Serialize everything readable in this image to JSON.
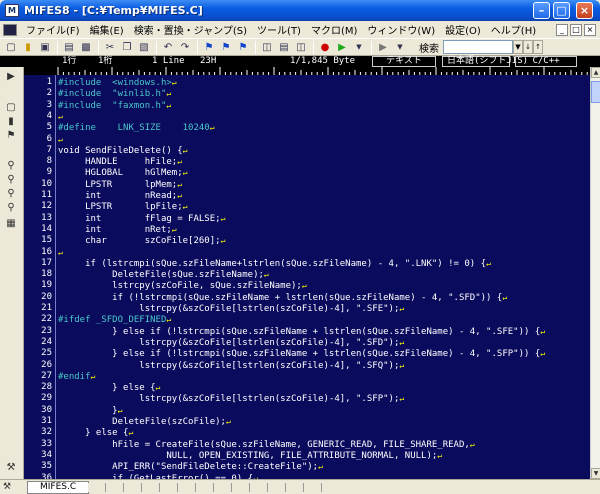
{
  "window": {
    "title": "MIFES8 - [C:¥Temp¥MIFES.C]",
    "app_icon": "M"
  },
  "menu": [
    "ファイル(F)",
    "編集(E)",
    "検索・置換・ジャンプ(S)",
    "ツール(T)",
    "マクロ(M)",
    "ウィンドウ(W)",
    "設定(O)",
    "ヘルプ(H)"
  ],
  "toolbar": {
    "search_label": "検索"
  },
  "status": {
    "col": "1行",
    "row": "1桁",
    "line": "1 Line",
    "char": "23H",
    "size": "1/1,845 Byte",
    "mode": "テキスト",
    "encoding": "日本語(シフトJIS)",
    "lang": "C/C++"
  },
  "lines": [
    {
      "n": "1",
      "t": "#include  <windows.h>",
      "pp": true
    },
    {
      "n": "2",
      "t": "#include  \"winlib.h\"",
      "pp": true
    },
    {
      "n": "3",
      "t": "#include  \"faxmon.h\"",
      "pp": true
    },
    {
      "n": "4",
      "t": ""
    },
    {
      "n": "5",
      "t": "#define    LNK_SIZE    10240",
      "pp": true
    },
    {
      "n": "6",
      "t": ""
    },
    {
      "n": "7",
      "t": "void SendFileDelete() {"
    },
    {
      "n": "8",
      "t": "     HANDLE     hFile;"
    },
    {
      "n": "9",
      "t": "     HGLOBAL    hGlMem;"
    },
    {
      "n": "10",
      "t": "     LPSTR      lpMem;"
    },
    {
      "n": "11",
      "t": "     int        nRead;"
    },
    {
      "n": "12",
      "t": "     LPSTR      lpFile;"
    },
    {
      "n": "13",
      "t": "     int        fFlag = FALSE;"
    },
    {
      "n": "14",
      "t": "     int        nRet;"
    },
    {
      "n": "15",
      "t": "     char       szCoFile[260];"
    },
    {
      "n": "16",
      "t": ""
    },
    {
      "n": "17",
      "t": "     if (lstrcmpi(sQue.szFileName+lstrlen(sQue.szFileName) - 4, \".LNK\") != 0) {"
    },
    {
      "n": "18",
      "t": "          DeleteFile(sQue.szFileName);"
    },
    {
      "n": "19",
      "t": "          lstrcpy(szCoFile, sQue.szFileName);"
    },
    {
      "n": "20",
      "t": "          if (!lstrcmpi(sQue.szFileName + lstrlen(sQue.szFileName) - 4, \".SFD\")) {"
    },
    {
      "n": "21",
      "t": "               lstrcpy(&szCoFile[lstrlen(szCoFile)-4], \".SFE\");"
    },
    {
      "n": "22",
      "t": "#ifdef _SFDO_DEFINED",
      "pp": true
    },
    {
      "n": "23",
      "t": "          } else if (!lstrcmpi(sQue.szFileName + lstrlen(sQue.szFileName) - 4, \".SFE\")) {"
    },
    {
      "n": "24",
      "t": "               lstrcpy(&szCoFile[lstrlen(szCoFile)-4], \".SFD\");"
    },
    {
      "n": "25",
      "t": "          } else if (!lstrcmpi(sQue.szFileName + lstrlen(sQue.szFileName) - 4, \".SFP\")) {"
    },
    {
      "n": "26",
      "t": "               lstrcpy(&szCoFile[lstrlen(szCoFile)-4], \".SFQ\");"
    },
    {
      "n": "27",
      "t": "#endif",
      "pp": true
    },
    {
      "n": "28",
      "t": "          } else {"
    },
    {
      "n": "29",
      "t": "               lstrcpy(&szCoFile[lstrlen(szCoFile)-4], \".SFP\");"
    },
    {
      "n": "30",
      "t": "          }"
    },
    {
      "n": "31",
      "t": "          DeleteFile(szCoFile);"
    },
    {
      "n": "32",
      "t": "     } else {"
    },
    {
      "n": "33",
      "t": "          hFile = CreateFile(sQue.szFileName, GENERIC_READ, FILE_SHARE_READ,"
    },
    {
      "n": "34",
      "t": "                    NULL, OPEN_EXISTING, FILE_ATTRIBUTE_NORMAL, NULL);"
    },
    {
      "n": "35",
      "t": "          API_ERR(\"SendFileDelete::CreateFile\");"
    },
    {
      "n": "36",
      "t": "          if (GetLastError() == 0) {"
    }
  ],
  "tab": {
    "label": "MIFES.C"
  }
}
